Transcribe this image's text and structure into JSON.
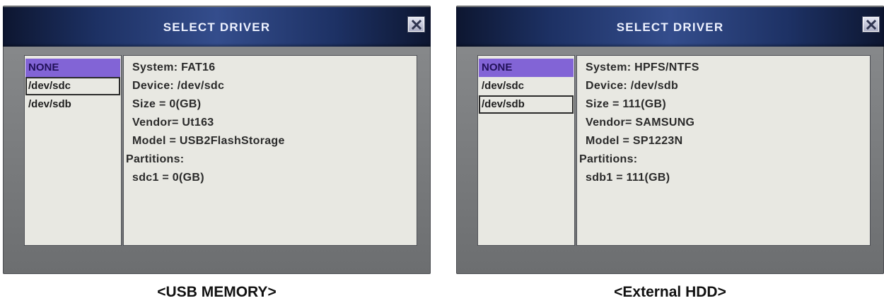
{
  "panels": [
    {
      "title": "SELECT DRIVER",
      "drivers": [
        "NONE",
        "/dev/sdc",
        "/dev/sdb"
      ],
      "info": {
        "system": "System: FAT16",
        "device": "Device: /dev/sdc",
        "size": "Size   = 0(GB)",
        "vendor": "Vendor= Ut163",
        "model": "Model = USB2FlashStorage",
        "partitions_label": "Partitions:",
        "partition": "sdc1  = 0(GB)"
      },
      "caption": "<USB MEMORY>"
    },
    {
      "title": "SELECT DRIVER",
      "drivers": [
        "NONE",
        "/dev/sdc",
        "/dev/sdb"
      ],
      "info": {
        "system": "System: HPFS/NTFS",
        "device": "Device: /dev/sdb",
        "size": "Size   = 111(GB)",
        "vendor": "Vendor= SAMSUNG",
        "model": "Model = SP1223N",
        "partitions_label": "Partitions:",
        "partition": "sdb1  = 111(GB)"
      },
      "caption": "<External HDD>"
    }
  ],
  "icons": {
    "close": "close-x-icon"
  },
  "colors": {
    "titlebar_center": "#344d8c",
    "titlebar_edge": "#0d1630",
    "selected_item": "#8264d6",
    "list_background": "#e8e8e2",
    "bezel": "#7a7c7e"
  }
}
